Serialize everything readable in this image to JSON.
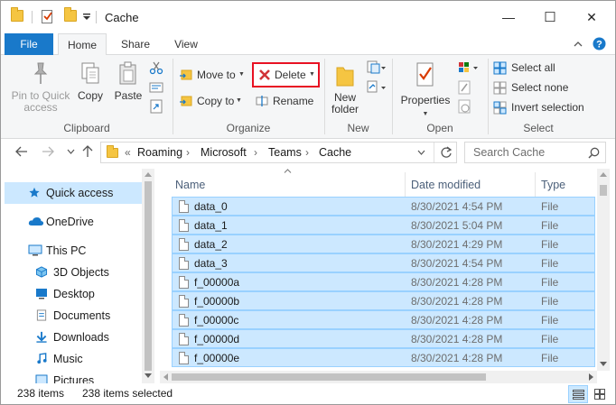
{
  "window": {
    "title": "Cache",
    "minimize_glyph": "—",
    "maximize_glyph": "☐",
    "close_glyph": "✕"
  },
  "ribbon_tabs": [
    "File",
    "Home",
    "Share",
    "View"
  ],
  "ribbon": {
    "clipboard": {
      "label": "Clipboard",
      "pin_label_1": "Pin to Quick",
      "pin_label_2": "access",
      "copy": "Copy",
      "paste": "Paste"
    },
    "organize": {
      "label": "Organize",
      "move_to": "Move to",
      "copy_to": "Copy to",
      "delete": "Delete",
      "rename": "Rename"
    },
    "new": {
      "label": "New",
      "new_folder_1": "New",
      "new_folder_2": "folder"
    },
    "open": {
      "label": "Open",
      "properties": "Properties"
    },
    "select": {
      "label": "Select",
      "select_all": "Select all",
      "select_none": "Select none",
      "invert": "Invert selection"
    }
  },
  "address": {
    "overflow": "«",
    "crumbs": [
      "Roaming",
      "Microsoft",
      "Teams",
      "Cache"
    ],
    "search_placeholder": "Search Cache"
  },
  "nav_pane": [
    {
      "label": "Quick access",
      "icon": "star-icon",
      "selected": true
    },
    {
      "label": "OneDrive",
      "icon": "cloud-icon",
      "selected": false
    },
    {
      "label": "This PC",
      "icon": "computer-icon",
      "selected": false
    },
    {
      "label": "3D Objects",
      "icon": "cube-icon",
      "selected": false
    },
    {
      "label": "Desktop",
      "icon": "desktop-icon",
      "selected": false
    },
    {
      "label": "Documents",
      "icon": "document-icon",
      "selected": false
    },
    {
      "label": "Downloads",
      "icon": "download-arrow-icon",
      "selected": false
    },
    {
      "label": "Music",
      "icon": "music-note-icon",
      "selected": false
    },
    {
      "label": "Pictures",
      "icon": "picture-icon",
      "selected": false
    }
  ],
  "file_list": {
    "columns": [
      "Name",
      "Date modified",
      "Type"
    ],
    "rows": [
      {
        "name": "data_0",
        "date": "8/30/2021 4:54 PM",
        "type": "File"
      },
      {
        "name": "data_1",
        "date": "8/30/2021 5:04 PM",
        "type": "File"
      },
      {
        "name": "data_2",
        "date": "8/30/2021 4:29 PM",
        "type": "File"
      },
      {
        "name": "data_3",
        "date": "8/30/2021 4:54 PM",
        "type": "File"
      },
      {
        "name": "f_00000a",
        "date": "8/30/2021 4:28 PM",
        "type": "File"
      },
      {
        "name": "f_00000b",
        "date": "8/30/2021 4:28 PM",
        "type": "File"
      },
      {
        "name": "f_00000c",
        "date": "8/30/2021 4:28 PM",
        "type": "File"
      },
      {
        "name": "f_00000d",
        "date": "8/30/2021 4:28 PM",
        "type": "File"
      },
      {
        "name": "f_00000e",
        "date": "8/30/2021 4:28 PM",
        "type": "File"
      }
    ]
  },
  "status_bar": {
    "item_count": "238 items",
    "selected_count": "238 items selected"
  },
  "colors": {
    "accent": "#1979ca",
    "selection_fill": "#cce8ff",
    "selection_border": "#99d1ff",
    "delete_highlight": "#e81123"
  }
}
